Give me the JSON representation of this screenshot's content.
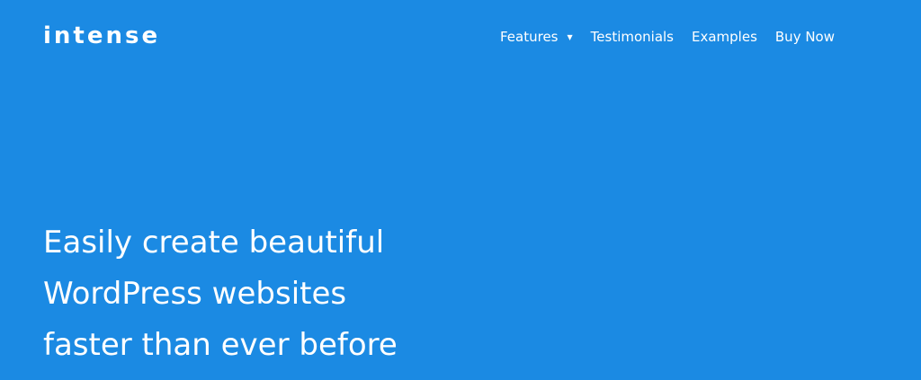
{
  "brand": {
    "logo_text": "intense"
  },
  "nav": {
    "items": [
      {
        "label": "Features",
        "has_dropdown": true
      },
      {
        "label": "Testimonials"
      },
      {
        "label": "Examples"
      },
      {
        "label": "Buy Now"
      }
    ],
    "dropdown_glyph": "▼"
  },
  "hero": {
    "lines": [
      "Easily create beautiful",
      "WordPress websites",
      "faster than ever before"
    ]
  },
  "colors": {
    "background": "#1b8ae3",
    "text": "#ffffff"
  }
}
